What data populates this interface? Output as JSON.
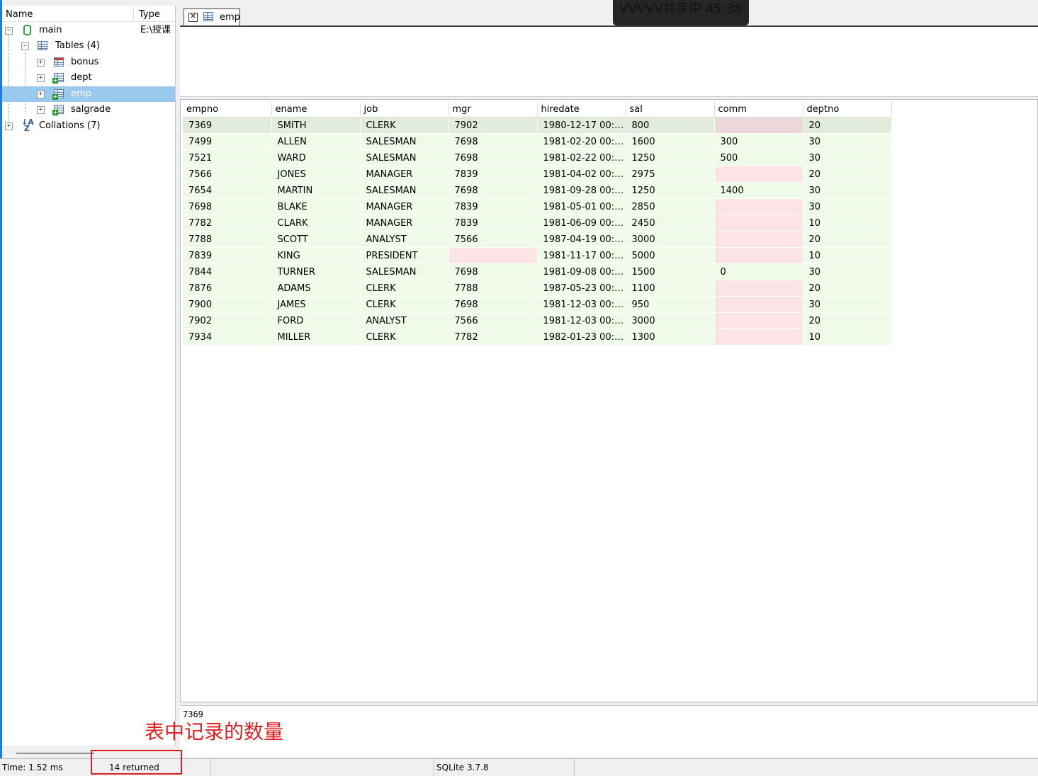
{
  "tree": {
    "header_name": "Name",
    "header_type": "Type",
    "db_name": "main",
    "db_type": "E:\\授课",
    "tables_label": "Tables (4)",
    "tables": [
      "bonus",
      "dept",
      "emp",
      "salgrade"
    ],
    "selected": "emp",
    "collations_label": "Collations (7)"
  },
  "tab": {
    "label": "emp",
    "close_glyph": "✕"
  },
  "overlay_text": "VVVVV共享中 45:38",
  "grid": {
    "columns": [
      "empno",
      "ename",
      "job",
      "mgr",
      "hiredate",
      "sal",
      "comm",
      "deptno"
    ],
    "rows": [
      [
        "7369",
        "SMITH",
        "CLERK",
        "7902",
        "1980-12-17 00:…",
        "800",
        null,
        "20"
      ],
      [
        "7499",
        "ALLEN",
        "SALESMAN",
        "7698",
        "1981-02-20 00:…",
        "1600",
        "300",
        "30"
      ],
      [
        "7521",
        "WARD",
        "SALESMAN",
        "7698",
        "1981-02-22 00:…",
        "1250",
        "500",
        "30"
      ],
      [
        "7566",
        "JONES",
        "MANAGER",
        "7839",
        "1981-04-02 00:…",
        "2975",
        null,
        "20"
      ],
      [
        "7654",
        "MARTIN",
        "SALESMAN",
        "7698",
        "1981-09-28 00:…",
        "1250",
        "1400",
        "30"
      ],
      [
        "7698",
        "BLAKE",
        "MANAGER",
        "7839",
        "1981-05-01 00:…",
        "2850",
        null,
        "30"
      ],
      [
        "7782",
        "CLARK",
        "MANAGER",
        "7839",
        "1981-06-09 00:…",
        "2450",
        null,
        "10"
      ],
      [
        "7788",
        "SCOTT",
        "ANALYST",
        "7566",
        "1987-04-19 00:…",
        "3000",
        null,
        "20"
      ],
      [
        "7839",
        "KING",
        "PRESIDENT",
        null,
        "1981-11-17 00:…",
        "5000",
        null,
        "10"
      ],
      [
        "7844",
        "TURNER",
        "SALESMAN",
        "7698",
        "1981-09-08 00:…",
        "1500",
        "0",
        "30"
      ],
      [
        "7876",
        "ADAMS",
        "CLERK",
        "7788",
        "1987-05-23 00:…",
        "1100",
        null,
        "20"
      ],
      [
        "7900",
        "JAMES",
        "CLERK",
        "7698",
        "1981-12-03 00:…",
        "950",
        null,
        "30"
      ],
      [
        "7902",
        "FORD",
        "ANALYST",
        "7566",
        "1981-12-03 00:…",
        "3000",
        null,
        "20"
      ],
      [
        "7934",
        "MILLER",
        "CLERK",
        "7782",
        "1982-01-23 00:…",
        "1300",
        null,
        "10"
      ]
    ]
  },
  "value_preview": "7369",
  "annotation": "表中记录的数量",
  "status": {
    "time": "Time: 1.52 ms",
    "returned": "14 returned",
    "version": "SQLite 3.7.8"
  },
  "colors": {
    "annotation": "#e02020",
    "selection": "#99c9ef",
    "null_cell": "#fce3e5",
    "cell": "#effbe8"
  }
}
